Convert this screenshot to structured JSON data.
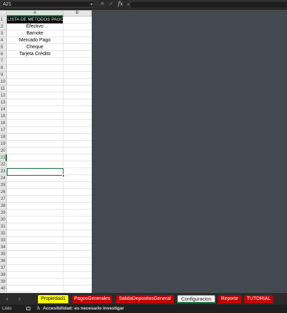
{
  "formula_bar": {
    "name_box": "A21",
    "formula": ""
  },
  "columns": [
    "A",
    "B"
  ],
  "rows": [
    "1",
    "2",
    "3",
    "4",
    "5",
    "6",
    "7",
    "8",
    "9",
    "10",
    "11",
    "12",
    "13",
    "14",
    "15",
    "16",
    "17",
    "18",
    "19",
    "20",
    "21",
    "22",
    "23",
    "24",
    "25",
    "26",
    "27",
    "28",
    "29",
    "30",
    "31",
    "32",
    "33",
    "34",
    "35",
    "36",
    "37",
    "38",
    "39",
    "40"
  ],
  "cells": {
    "A1": "LISTA DE METODOS PAGO",
    "A2": "Efectivo",
    "A3": "Barnote",
    "A4": "Mercado Pago",
    "A5": "Cheque",
    "A6": "Tarjeta Crédito"
  },
  "sheet_tabs": [
    {
      "label": "Propiedad1",
      "color": "#ffff00"
    },
    {
      "label": "PagosGenerales",
      "color": "#c00000"
    },
    {
      "label": "SalidaDepositosGeneral",
      "color": "#c00000"
    },
    {
      "label": "Configuracion",
      "color": "#217346",
      "active": true
    },
    {
      "label": "Reporte",
      "color": "#c00000"
    },
    {
      "label": "TUTORIAL",
      "color": "#c00000"
    }
  ],
  "status": {
    "ready": "Listo",
    "accessibility": "Accesibilidad: es necesario investigar"
  },
  "colors": {
    "grid_selection": "#217346",
    "workspace": "#44494f"
  }
}
